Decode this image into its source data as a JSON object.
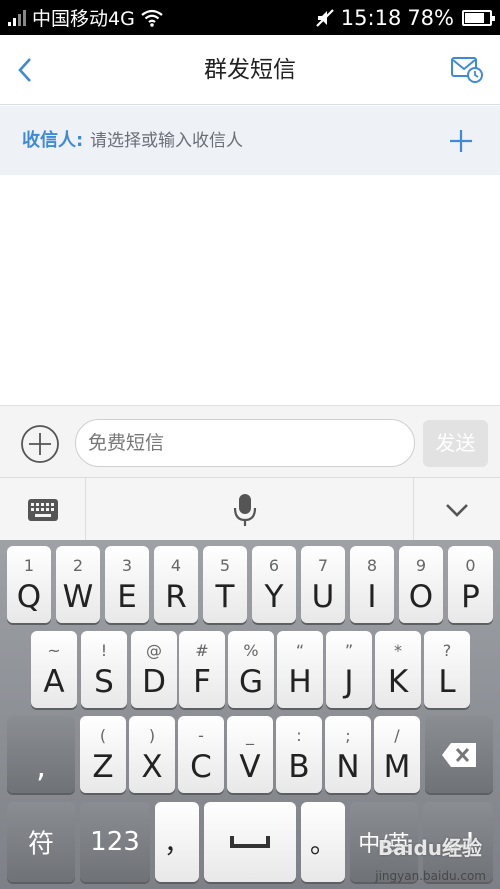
{
  "status_bar": {
    "carrier": "中国移动4G",
    "time": "15:18",
    "battery": "78%",
    "battery_level": 0.78
  },
  "header": {
    "title": "群发短信",
    "back_icon": "chevron-left-icon",
    "inbox_icon": "scheduled-mail-icon",
    "accent_color": "#3f8ad8"
  },
  "recipient": {
    "label": "收信人:",
    "placeholder": "请选择或输入收信人",
    "add_icon": "plus-icon"
  },
  "compose": {
    "placeholder": "免费短信",
    "send_label": "发送",
    "attach_icon": "plus-circle-icon"
  },
  "keyboard": {
    "toolbar": [
      "keyboard-icon",
      "microphone-icon",
      "chevron-down-icon"
    ],
    "row1": [
      {
        "hint": "1",
        "label": "Q"
      },
      {
        "hint": "2",
        "label": "W"
      },
      {
        "hint": "3",
        "label": "E"
      },
      {
        "hint": "4",
        "label": "R"
      },
      {
        "hint": "5",
        "label": "T"
      },
      {
        "hint": "6",
        "label": "Y"
      },
      {
        "hint": "7",
        "label": "U"
      },
      {
        "hint": "8",
        "label": "I"
      },
      {
        "hint": "9",
        "label": "O"
      },
      {
        "hint": "0",
        "label": "P"
      }
    ],
    "row2": [
      {
        "hint": "~",
        "label": "A"
      },
      {
        "hint": "!",
        "label": "S"
      },
      {
        "hint": "@",
        "label": "D"
      },
      {
        "hint": "#",
        "label": "F"
      },
      {
        "hint": "%",
        "label": "G"
      },
      {
        "hint": "“",
        "label": "H"
      },
      {
        "hint": "”",
        "label": "J"
      },
      {
        "hint": "*",
        "label": "K"
      },
      {
        "hint": "?",
        "label": "L"
      }
    ],
    "row3_left": {
      "hint": "",
      "label": ","
    },
    "row3": [
      {
        "hint": "(",
        "label": "Z"
      },
      {
        "hint": ")",
        "label": "X"
      },
      {
        "hint": "-",
        "label": "C"
      },
      {
        "hint": "_",
        "label": "V"
      },
      {
        "hint": ":",
        "label": "B"
      },
      {
        "hint": ";",
        "label": "N"
      },
      {
        "hint": "/",
        "label": "M"
      }
    ],
    "backspace_icon": "backspace-icon",
    "row4": {
      "symbols": "符",
      "numbers": "123",
      "comma": "，",
      "period": "。",
      "lang": "中/英",
      "enter_icon": "enter-icon"
    }
  },
  "watermark": {
    "brand": "Baidu经验",
    "url": "jingyan.baidu.com"
  }
}
